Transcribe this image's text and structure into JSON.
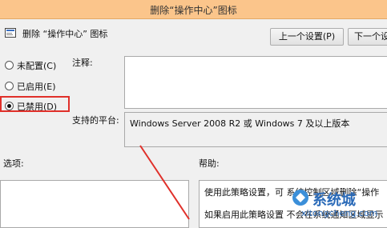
{
  "window": {
    "title": "删除“操作中心”图标"
  },
  "header": {
    "policy_name": "删除 “操作中心” 图标"
  },
  "nav": {
    "prev_label": "上一个设置(P)",
    "next_label": "下一个设"
  },
  "radios": [
    {
      "label": "未配置(C)",
      "checked": false
    },
    {
      "label": "已启用(E)",
      "checked": false
    },
    {
      "label": "已禁用(D)",
      "checked": true
    }
  ],
  "comment": {
    "label": "注释:",
    "value": ""
  },
  "platform": {
    "label": "支持的平台:",
    "value": "Windows Server 2008 R2 或 Windows 7 及以上版本"
  },
  "options": {
    "label": "选项:"
  },
  "help": {
    "label": "帮助:",
    "lines": [
      "使用此策略设置，可 系统控制区域删除“操作",
      "如果启用此策略设置  不会在系统通知区域显示"
    ]
  },
  "watermark": {
    "brand": "系统城",
    "url": "xitongcheng.com"
  },
  "colors": {
    "titlebar": "#fbc58b",
    "highlight": "#e0302a"
  }
}
